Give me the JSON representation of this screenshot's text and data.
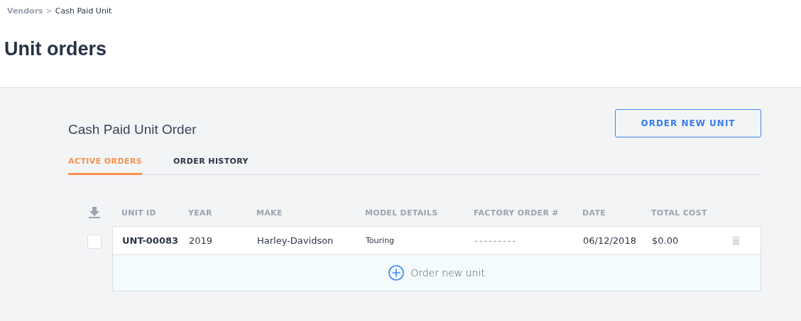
{
  "breadcrumb": [
    {
      "label": "Vendors",
      "current": false
    },
    {
      "label": "Cash Paid Unit",
      "current": true
    }
  ],
  "breadcrumb_separator": ">",
  "page_title": "Unit orders",
  "section_title": "Cash Paid Unit Order",
  "primary_button": "ORDER NEW UNIT",
  "tabs": [
    {
      "label": "ACTIVE ORDERS",
      "selected": true
    },
    {
      "label": "ORDER HISTORY",
      "selected": false
    }
  ],
  "table": {
    "columns": [
      "UNIT ID",
      "YEAR",
      "MAKE",
      "MODEL DETAILS",
      "FACTORY ORDER #",
      "DATE",
      "TOTAL COST"
    ],
    "rows": [
      {
        "checked": false,
        "cells": [
          "UNT-00083",
          "2019",
          "Harley-Davidson",
          "Touring",
          "---------",
          "06/12/2018",
          "$0.00"
        ]
      }
    ]
  },
  "add_row_label": "Order new unit"
}
